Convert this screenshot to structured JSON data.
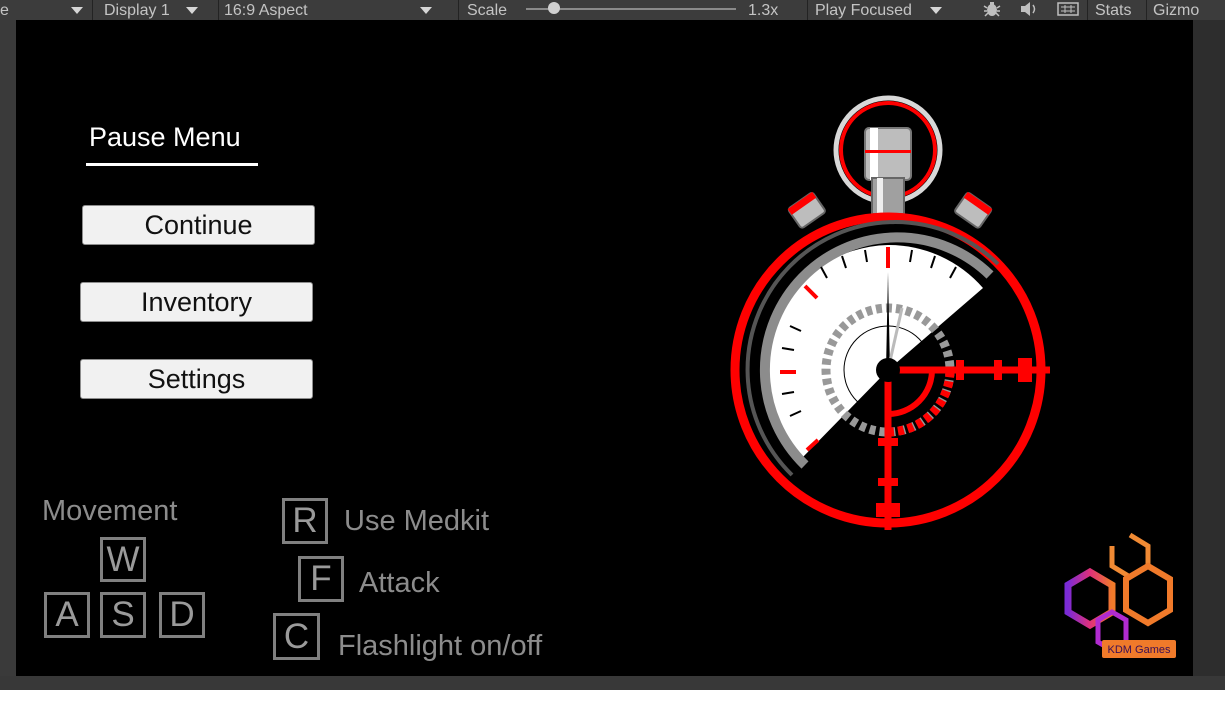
{
  "toolbar": {
    "game_tab_fragment": "e",
    "display": "Display 1",
    "aspect": "16:9 Aspect",
    "scale_label": "Scale",
    "scale_value": "1.3x",
    "play_mode": "Play Focused",
    "stats": "Stats",
    "gizmos": "Gizmo"
  },
  "pause_menu": {
    "title": "Pause Menu",
    "buttons": [
      "Continue",
      "Inventory",
      "Settings"
    ]
  },
  "controls": {
    "movement_label": "Movement",
    "movement_keys": [
      "W",
      "A",
      "S",
      "D"
    ],
    "actions": [
      {
        "key": "R",
        "label": "Use Medkit"
      },
      {
        "key": "F",
        "label": "Attack"
      },
      {
        "key": "C",
        "label": "Flashlight on/off"
      }
    ]
  },
  "logo": {
    "text": "KDM Games"
  },
  "colors": {
    "accent_red": "#ff0000",
    "background": "#000000",
    "toolbar": "#3c3c3c"
  },
  "icons": [
    "caret-down-icon",
    "slider-icon",
    "bug-icon",
    "audio-icon",
    "keyboard-icon",
    "stopwatch-icon",
    "hexagon-logo-icon"
  ]
}
